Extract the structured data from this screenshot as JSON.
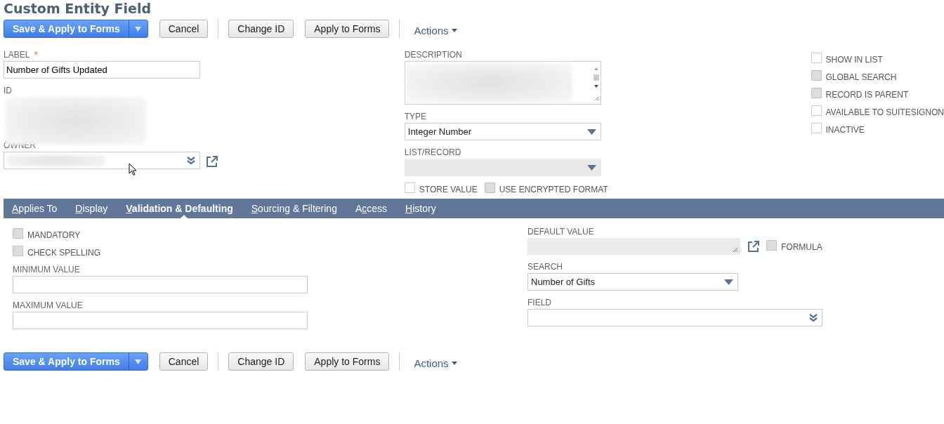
{
  "page_title": "Custom Entity Field",
  "toolbars": [
    {
      "primary": "Save & Apply to Forms",
      "buttons": [
        "Cancel",
        "Change ID",
        "Apply to Forms"
      ],
      "actions": "Actions"
    },
    {
      "primary": "Save & Apply to Forms",
      "buttons": [
        "Cancel",
        "Change ID",
        "Apply to Forms"
      ],
      "actions": "Actions"
    }
  ],
  "label_field": {
    "label": "LABEL",
    "required_mark": "*",
    "value": "Number of Gifts Updated"
  },
  "id_field": {
    "label": "ID"
  },
  "owner_field": {
    "label": "OWNER"
  },
  "description_field": {
    "label": "DESCRIPTION"
  },
  "type_field": {
    "label": "TYPE",
    "value": "Integer Number",
    "disabled": false
  },
  "list_record_field": {
    "label": "LIST/RECORD",
    "disabled": true
  },
  "store_options": [
    {
      "label": "STORE VALUE",
      "disabled": false,
      "checked": false
    },
    {
      "label": "USE ENCRYPTED FORMAT",
      "disabled": true,
      "checked": false
    }
  ],
  "flags": [
    {
      "label": "SHOW IN LIST",
      "disabled": false,
      "checked": false
    },
    {
      "label": "GLOBAL SEARCH",
      "disabled": true,
      "checked": false
    },
    {
      "label": "RECORD IS PARENT",
      "disabled": true,
      "checked": false
    },
    {
      "label": "AVAILABLE TO SUITESIGNON",
      "disabled": false,
      "checked": false
    },
    {
      "label": "INACTIVE",
      "disabled": false,
      "checked": false
    }
  ],
  "tabs": [
    {
      "key": "A",
      "post": "pplies To",
      "selected": false
    },
    {
      "key": "D",
      "post": "isplay",
      "selected": false
    },
    {
      "key": "V",
      "post": "alidation & Defaulting",
      "selected": true
    },
    {
      "key": "S",
      "post": "ourcing & Filtering",
      "selected": false
    },
    {
      "pre": "A",
      "key": "c",
      "post": "cess",
      "selected": false
    },
    {
      "key": "H",
      "post": "istory",
      "selected": false
    }
  ],
  "validation": {
    "checkboxes": [
      {
        "label": "MANDATORY",
        "disabled": true,
        "checked": false
      },
      {
        "label": "CHECK SPELLING",
        "disabled": true,
        "checked": false
      }
    ],
    "minimum_value": {
      "label": "MINIMUM VALUE"
    },
    "maximum_value": {
      "label": "MAXIMUM VALUE"
    }
  },
  "defaulting": {
    "default_value": {
      "label": "DEFAULT VALUE",
      "disabled": true
    },
    "formula": {
      "label": "FORMULA",
      "disabled": true,
      "checked": false
    },
    "search": {
      "label": "SEARCH",
      "value": "Number of Gifts"
    },
    "field": {
      "label": "FIELD"
    }
  }
}
